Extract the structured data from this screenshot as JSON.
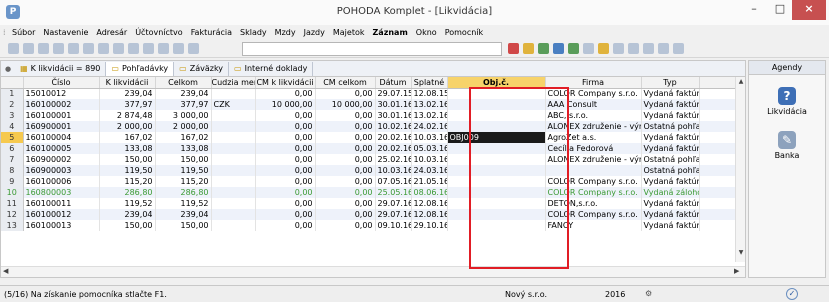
{
  "window": {
    "title": "POHODA Komplet - [Likvidácia]",
    "minimize_glyph": "–",
    "maximize_glyph": "□",
    "close_glyph": "×"
  },
  "menu": [
    "Súbor",
    "Nastavenie",
    "Adresár",
    "Účtovníctvo",
    "Fakturácia",
    "Sklady",
    "Mzdy",
    "Jazdy",
    "Majetok",
    "Záznam",
    "Okno",
    "Pomocník"
  ],
  "menu_bold": "Záznam",
  "tabs": [
    {
      "label": "K likvidácii = 890",
      "icon": "filter-icon"
    },
    {
      "label": "Pohľadávky",
      "icon": "folder-icon"
    },
    {
      "label": "Záväzky",
      "icon": "folder-icon"
    },
    {
      "label": "Interné doklady",
      "icon": "folder-icon"
    }
  ],
  "columns": [
    "",
    "Číslo",
    "K likvidácii",
    "Celkom",
    "Cudzia mena",
    "CM k likvidácii",
    "CM celkom",
    "Dátum",
    "Splatné",
    "Obj.č.",
    "Firma",
    "Typ"
  ],
  "rows": [
    {
      "n": "1",
      "cislo": "15010012",
      "klik": "239,04",
      "celkom": "239,04",
      "cm": "",
      "cmklik": "0,00",
      "cmcelkom": "0,00",
      "datum": "29.07.15",
      "splatne": "12.08.15",
      "obj": "",
      "firma": "COLOR Company s.r.o.",
      "typ": "Vydaná faktúra"
    },
    {
      "n": "2",
      "cislo": "160100002",
      "klik": "377,97",
      "celkom": "377,97",
      "cm": "CZK",
      "cmklik": "10 000,00",
      "cmcelkom": "10 000,00",
      "datum": "30.01.16",
      "splatne": "13.02.16",
      "obj": "",
      "firma": "AAA Consult",
      "typ": "Vydaná faktúra"
    },
    {
      "n": "3",
      "cislo": "160100001",
      "klik": "2 874,48",
      "celkom": "3 000,00",
      "cm": "",
      "cmklik": "0,00",
      "cmcelkom": "0,00",
      "datum": "30.01.16",
      "splatne": "13.02.16",
      "obj": "",
      "firma": "ABC, s.r.o.",
      "typ": "Vydaná faktúra"
    },
    {
      "n": "4",
      "cislo": "160900001",
      "klik": "2 000,00",
      "celkom": "2 000,00",
      "cm": "",
      "cmklik": "0,00",
      "cmcelkom": "0,00",
      "datum": "10.02.16",
      "splatne": "24.02.16",
      "obj": "",
      "firma": "ALONEX združenie - výr",
      "typ": "Ostatná pohľadá"
    },
    {
      "n": "5",
      "cislo": "160100004",
      "klik": "167,02",
      "celkom": "167,02",
      "cm": "",
      "cmklik": "0,00",
      "cmcelkom": "0,00",
      "datum": "20.02.16",
      "splatne": "10.03.16",
      "obj": "OBJ009",
      "firma": "AgroZet a.s.",
      "typ": "Vydaná faktúra"
    },
    {
      "n": "6",
      "cislo": "160100005",
      "klik": "133,08",
      "celkom": "133,08",
      "cm": "",
      "cmklik": "0,00",
      "cmcelkom": "0,00",
      "datum": "20.02.16",
      "splatne": "05.03.16",
      "obj": "",
      "firma": "Cecília Fedorová",
      "typ": "Vydaná faktúra"
    },
    {
      "n": "7",
      "cislo": "160900002",
      "klik": "150,00",
      "celkom": "150,00",
      "cm": "",
      "cmklik": "0,00",
      "cmcelkom": "0,00",
      "datum": "25.02.16",
      "splatne": "10.03.16",
      "obj": "",
      "firma": "ALONEX združenie - výr",
      "typ": "Ostatná pohľadá"
    },
    {
      "n": "8",
      "cislo": "160900003",
      "klik": "119,50",
      "celkom": "119,50",
      "cm": "",
      "cmklik": "0,00",
      "cmcelkom": "0,00",
      "datum": "10.03.16",
      "splatne": "24.03.16",
      "obj": "",
      "firma": "",
      "typ": "Ostatná pohľadá"
    },
    {
      "n": "9",
      "cislo": "160100006",
      "klik": "115,20",
      "celkom": "115,20",
      "cm": "",
      "cmklik": "0,00",
      "cmcelkom": "0,00",
      "datum": "07.05.16",
      "splatne": "21.05.16",
      "obj": "",
      "firma": "COLOR Company s.r.o.",
      "typ": "Vydaná faktúra"
    },
    {
      "n": "10",
      "cislo": "160800003",
      "klik": "286,80",
      "celkom": "286,80",
      "cm": "",
      "cmklik": "0,00",
      "cmcelkom": "0,00",
      "datum": "25.05.16",
      "splatne": "08.06.16",
      "obj": "",
      "firma": "COLOR Company s.r.o.",
      "typ": "Vydaná zálohová"
    },
    {
      "n": "11",
      "cislo": "160100011",
      "klik": "119,52",
      "celkom": "119,52",
      "cm": "",
      "cmklik": "0,00",
      "cmcelkom": "0,00",
      "datum": "29.07.16",
      "splatne": "12.08.16",
      "obj": "",
      "firma": "DETON,s.r.o.",
      "typ": "Vydaná faktúra"
    },
    {
      "n": "12",
      "cislo": "160100012",
      "klik": "239,04",
      "celkom": "239,04",
      "cm": "",
      "cmklik": "0,00",
      "cmcelkom": "0,00",
      "datum": "29.07.16",
      "splatne": "12.08.16",
      "obj": "",
      "firma": "COLOR Company s.r.o.",
      "typ": "Vydaná faktúra"
    },
    {
      "n": "13",
      "cislo": "160100013",
      "klik": "150,00",
      "celkom": "150,00",
      "cm": "",
      "cmklik": "0,00",
      "cmcelkom": "0,00",
      "datum": "09.10.16",
      "splatne": "29.10.16",
      "obj": "",
      "firma": "FANCY",
      "typ": "Vydaná faktúra"
    }
  ],
  "selected_row": "5",
  "green_row": "10",
  "agendy": {
    "title": "Agendy",
    "items": [
      {
        "label": "Likvidácia",
        "icon": "info-icon",
        "glyph": "?"
      },
      {
        "label": "Banka",
        "icon": "bank-icon",
        "glyph": "✎"
      }
    ]
  },
  "status": {
    "hint": "(5/16) Na získanie pomocníka stlačte F1.",
    "company": "Nový s.r.o.",
    "year": "2016"
  },
  "colors": {
    "highlight_box": "#e11d25",
    "selected_row_marker": "#f6c94e",
    "green_text": "#3b9a34"
  }
}
